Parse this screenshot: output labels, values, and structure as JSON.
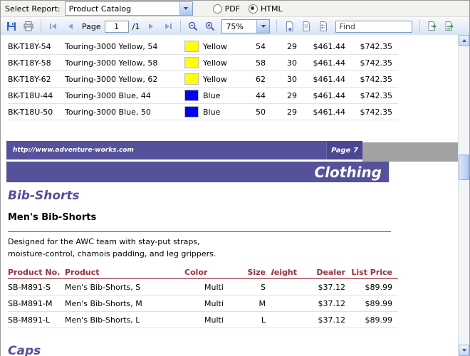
{
  "select_bar": {
    "label": "Select Report:",
    "report_name": "Product Catalog",
    "formats": {
      "pdf": "PDF",
      "html": "HTML"
    },
    "selected_format": "HTML"
  },
  "toolbar": {
    "page_label": "Page",
    "current_page": "1",
    "total_pages": "/1",
    "zoom": "75%",
    "find_placeholder": "Find"
  },
  "report": {
    "columns": [
      "Product No.",
      "Product",
      "Color",
      "Size",
      "Weight",
      "Dealer",
      "List Price"
    ],
    "page7_rows": [
      {
        "product_no": "BK-T18Y-54",
        "product": "Touring-3000 Yellow, 54",
        "swatch": "#FFFF00",
        "color": "Yellow",
        "size": "54",
        "weight": "29",
        "dealer": "$461.44",
        "list_price": "$742.35"
      },
      {
        "product_no": "BK-T18Y-58",
        "product": "Touring-3000 Yellow, 58",
        "swatch": "#FFFF00",
        "color": "Yellow",
        "size": "58",
        "weight": "30",
        "dealer": "$461.44",
        "list_price": "$742.35"
      },
      {
        "product_no": "BK-T18Y-62",
        "product": "Touring-3000 Yellow, 62",
        "swatch": "#FFFF00",
        "color": "Yellow",
        "size": "62",
        "weight": "30",
        "dealer": "$461.44",
        "list_price": "$742.35"
      },
      {
        "product_no": "BK-T18U-44",
        "product": "Touring-3000 Blue, 44",
        "swatch": "#0000FF",
        "color": "Blue",
        "size": "44",
        "weight": "29",
        "dealer": "$461.44",
        "list_price": "$742.35"
      },
      {
        "product_no": "BK-T18U-50",
        "product": "Touring-3000 Blue, 50",
        "swatch": "#0000FF",
        "color": "Blue",
        "size": "50",
        "weight": "29",
        "dealer": "$461.44",
        "list_price": "$742.35"
      }
    ],
    "page_footer": {
      "url": "http://www.adventure-works.com",
      "page_number": "Page 7"
    },
    "category": "Clothing",
    "subcategory": "Bib-Shorts",
    "product_name": "Men's Bib-Shorts",
    "description": [
      "Designed for the AWC team with stay-put straps,",
      "moisture-control, chamois padding, and leg grippers."
    ],
    "page8_rows": [
      {
        "product_no": "SB-M891-S",
        "product": "Men's Bib-Shorts, S",
        "color": "Multi",
        "size": "S",
        "weight": "",
        "dealer": "$37.12",
        "list_price": "$89.99"
      },
      {
        "product_no": "SB-M891-M",
        "product": "Men's Bib-Shorts, M",
        "color": "Multi",
        "size": "M",
        "weight": "",
        "dealer": "$37.12",
        "list_price": "$89.99"
      },
      {
        "product_no": "SB-M891-L",
        "product": "Men's Bib-Shorts, L",
        "color": "Multi",
        "size": "L",
        "weight": "",
        "dealer": "$37.12",
        "list_price": "$89.99"
      }
    ],
    "next_section": "Caps"
  },
  "colors": {
    "accent_purple": "#55519B",
    "accent_purple_dark": "#4B4791",
    "header_maroon": "#9B3040",
    "heading_purple": "#534FA0",
    "swatch_yellow": "#FFFF00",
    "swatch_blue": "#0000FF"
  },
  "icons": {
    "list": [
      "save-icon",
      "print-icon",
      "first-page-icon",
      "prev-page-icon",
      "next-page-icon",
      "last-page-icon",
      "zoom-out-icon",
      "zoom-in-icon",
      "print-layout-icon",
      "page-setup-icon",
      "document-map-icon",
      "find-icon",
      "find-next-icon",
      "scroll-up-icon",
      "scroll-down-icon",
      "dropdown-arrow-icon"
    ]
  }
}
